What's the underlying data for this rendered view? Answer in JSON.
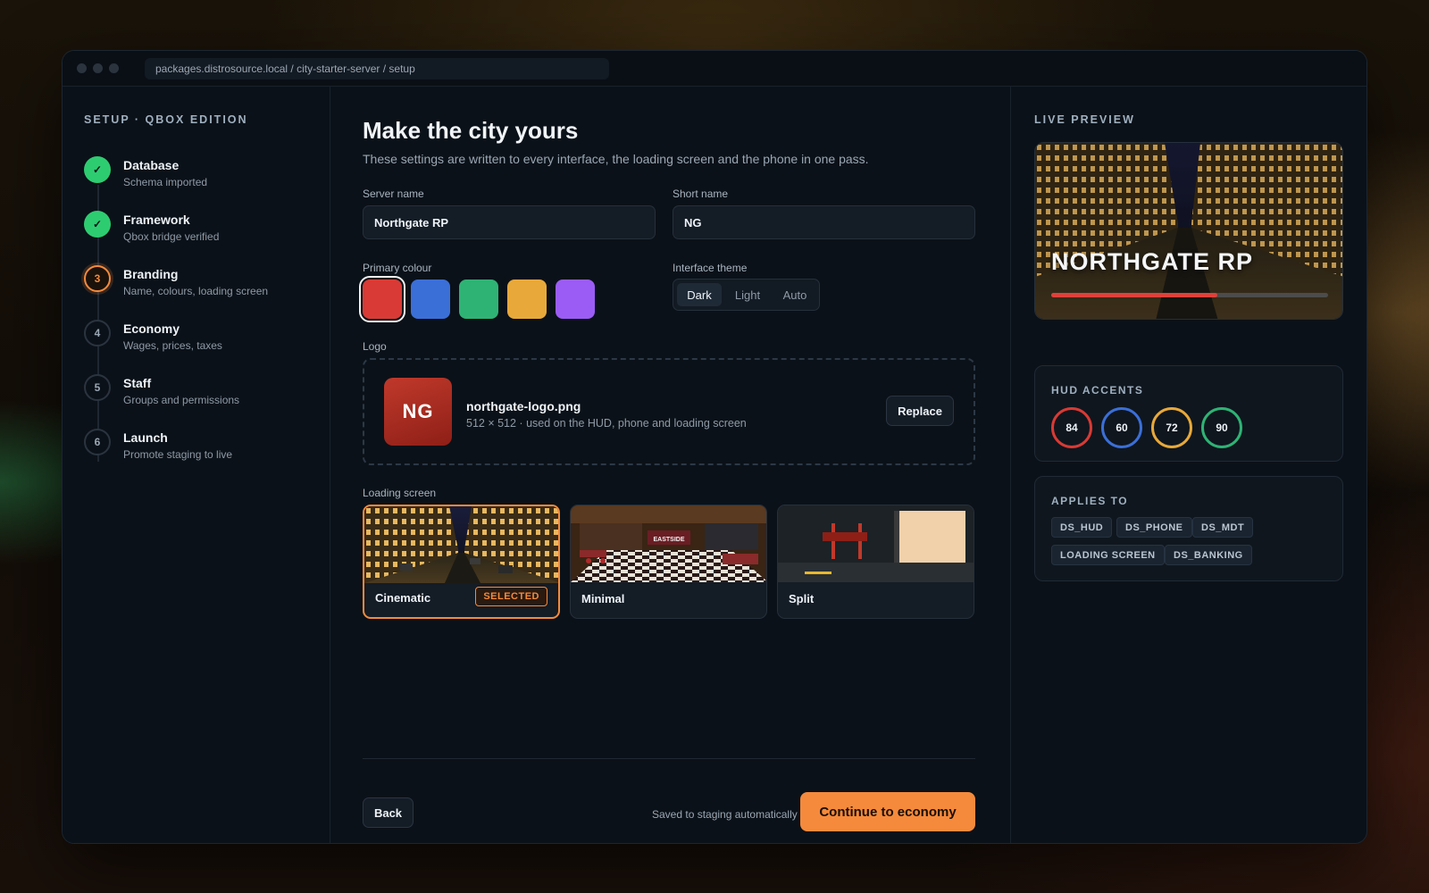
{
  "browser": {
    "url": "packages.distrosource.local / city-starter-server / setup"
  },
  "sidebar": {
    "title": "SETUP · QBOX EDITION",
    "steps": [
      {
        "marker": "✓",
        "title": "Database",
        "subtitle": "Schema imported",
        "state": "done"
      },
      {
        "marker": "✓",
        "title": "Framework",
        "subtitle": "Qbox bridge verified",
        "state": "done"
      },
      {
        "marker": "3",
        "title": "Branding",
        "subtitle": "Name, colours, loading screen",
        "state": "active"
      },
      {
        "marker": "4",
        "title": "Economy",
        "subtitle": "Wages, prices, taxes",
        "state": "pending"
      },
      {
        "marker": "5",
        "title": "Staff",
        "subtitle": "Groups and permissions",
        "state": "pending"
      },
      {
        "marker": "6",
        "title": "Launch",
        "subtitle": "Promote staging to live",
        "state": "pending"
      }
    ]
  },
  "main": {
    "title": "Make the city yours",
    "subtitle": "These settings are written to every interface, the loading screen and the phone in one pass.",
    "server_name": {
      "label": "Server name",
      "value": "Northgate RP"
    },
    "short_name": {
      "label": "Short name",
      "value": "NG"
    },
    "primary_colour": {
      "label": "Primary colour",
      "swatches": [
        "#d93a35",
        "#3b6fd8",
        "#2fb374",
        "#e8a93a",
        "#9b5cf5"
      ],
      "selected": 0
    },
    "theme": {
      "label": "Interface theme",
      "options": [
        "Dark",
        "Light",
        "Auto"
      ],
      "selected": "Dark"
    },
    "logo": {
      "label": "Logo",
      "badge_text": "NG",
      "file_name": "northgate-logo.png",
      "meta": "512 × 512 · used on the HUD, phone and loading screen",
      "replace_label": "Replace"
    },
    "loading_screen": {
      "label": "Loading screen",
      "options": [
        {
          "name": "Cinematic",
          "selected": true
        },
        {
          "name": "Minimal",
          "selected": false
        },
        {
          "name": "Split",
          "selected": false
        }
      ],
      "selected_badge": "SELECTED",
      "sign_text": "EASTSIDE"
    },
    "footer": {
      "back_label": "Back",
      "saved_note": "Saved to staging automatically",
      "continue_label": "Continue to economy"
    }
  },
  "preview": {
    "title": "LIVE PREVIEW",
    "server_name": "NORTHGATE RP",
    "progress": 0.6
  },
  "hud_accents": {
    "title": "HUD ACCENTS",
    "rings": [
      {
        "value": "84",
        "color": "#d93a35"
      },
      {
        "value": "60",
        "color": "#3b6fd8"
      },
      {
        "value": "72",
        "color": "#e8a93a"
      },
      {
        "value": "90",
        "color": "#2fb374"
      }
    ]
  },
  "applies_to": {
    "title": "APPLIES TO",
    "chips": [
      "DS_HUD",
      "DS_PHONE",
      "DS_MDT",
      "LOADING SCREEN",
      "DS_BANKING"
    ]
  },
  "colors": {
    "accent": "#f58a3c",
    "done": "#2ecc71"
  }
}
